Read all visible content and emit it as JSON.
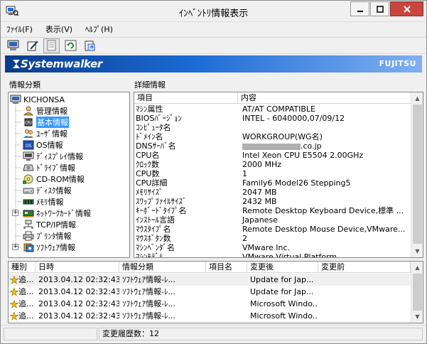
{
  "window": {
    "title": "ｲﾝﾍﾞﾝﾄﾘ情報表示"
  },
  "menu": {
    "file": "ﾌｧｲﾙ(F)",
    "view": "表示(V)",
    "help": "ﾍﾙﾌﾟ(H)"
  },
  "toolbar": {
    "buttons": [
      "computer-icon",
      "edit-icon",
      "document-icon",
      "refresh-icon",
      "export-icon"
    ]
  },
  "banner": {
    "product": "Systemwalker",
    "vendor": "FUJITSU"
  },
  "tree": {
    "section_label": "情報分類",
    "root": "KICHONSA",
    "items": [
      {
        "label": "管理情報",
        "icon": "user-icon"
      },
      {
        "label": "基本情報",
        "icon": "cpu-icon",
        "selected": true
      },
      {
        "label": "ﾕｰｻﾞ情報",
        "icon": "users-icon"
      },
      {
        "label": "OS情報",
        "icon": "os-icon"
      },
      {
        "label": "ﾃﾞｨｽﾌﾟﾚｲ情報",
        "icon": "display-icon"
      },
      {
        "label": "ﾄﾞﾗｲﾌﾞ情報",
        "icon": "drive-icon"
      },
      {
        "label": "CD-ROM情報",
        "icon": "cdrom-icon"
      },
      {
        "label": "ﾃﾞｨｽｸ情報",
        "icon": "disk-icon"
      },
      {
        "label": "ﾒﾓﾘ情報",
        "icon": "memory-icon"
      },
      {
        "label": "ﾈｯﾄﾜｰｸｶｰﾄﾞ情報",
        "icon": "network-card-icon",
        "expandable": true
      },
      {
        "label": "TCP/IP情報",
        "icon": "network-icon"
      },
      {
        "label": "ﾌﾟﾘﾝﾀ情報",
        "icon": "printer-icon"
      },
      {
        "label": "ｿﾌﾄｳｪｱ情報",
        "icon": "software-icon",
        "expandable": true
      }
    ]
  },
  "details": {
    "section_label": "詳細情報",
    "headers": [
      "項目",
      "内容"
    ],
    "rows": [
      {
        "item": "ﾏｼﾝ属性",
        "value": "AT/AT COMPATIBLE"
      },
      {
        "item": "BIOSﾊﾞｰｼﾞｮﾝ",
        "value": "INTEL  - 6040000,07/09/12"
      },
      {
        "item": "ｺﾝﾋﾟｭｰﾀ名",
        "value": ""
      },
      {
        "item": "ﾄﾞﾒｲﾝ名",
        "value": "WORKGROUP(WG名)"
      },
      {
        "item": "DNSｻｰﾊﾞ名",
        "value": ".co.jp",
        "redacted": true
      },
      {
        "item": "CPU名",
        "value": "Intel Xeon CPU E5504 2.00GHz"
      },
      {
        "item": "ｸﾛｯｸ数",
        "value": "2000 MHz"
      },
      {
        "item": "CPU数",
        "value": "1"
      },
      {
        "item": "CPU詳細",
        "value": "Family6 Model26 Stepping5"
      },
      {
        "item": "ﾒﾓﾘｻｲｽﾞ",
        "value": "2047 MB"
      },
      {
        "item": "ｽﾜｯﾌﾟﾌｧｲﾙｻｲｽﾞ",
        "value": "2432 MB"
      },
      {
        "item": "ｷｰﾎﾞｰﾄﾞﾀｲﾌﾟ名",
        "value": "Remote Desktop Keyboard Device,標準 ..."
      },
      {
        "item": "ｲﾝｽﾄｰﾙ言語",
        "value": "Japanese"
      },
      {
        "item": "ﾏｳｽﾀｲﾌﾟ名",
        "value": "Remote Desktop Mouse Device,VMware..."
      },
      {
        "item": "ﾏｳｽﾎﾞﾀﾝ数",
        "value": "2"
      },
      {
        "item": "ﾏｼﾝﾍﾞﾝﾀﾞ名",
        "value": "VMware  Inc."
      },
      {
        "item": "ﾏｼﾝﾓﾃﾞﾙ",
        "value": "VMware Virtual Platform"
      }
    ]
  },
  "history": {
    "headers": [
      "種別",
      "日時",
      "情報分類",
      "項目名",
      "変更後",
      "変更前"
    ],
    "rows": [
      {
        "type": "追...",
        "datetime": "2013.04.12 02:32:43",
        "category": "ｿﾌﾄｳｪｱ情報-ﾚ...",
        "item": "",
        "after": "Update for Jap...",
        "before": ""
      },
      {
        "type": "追...",
        "datetime": "2013.04.12 02:32:43",
        "category": "ｿﾌﾄｳｪｱ情報-ﾚ...",
        "item": "",
        "after": "Update for Jap...",
        "before": ""
      },
      {
        "type": "追...",
        "datetime": "2013.04.12 02:32:43",
        "category": "ｿﾌﾄｳｪｱ情報-ﾚ...",
        "item": "",
        "after": "Microsoft Windo...",
        "before": ""
      },
      {
        "type": "追...",
        "datetime": "2013.04.12 02:32:43",
        "category": "ｿﾌﾄｳｪｱ情報-ﾚ...",
        "item": "",
        "after": "Microsoft Windo...",
        "before": ""
      }
    ]
  },
  "status": {
    "history_count": "変更履歴数：12"
  }
}
